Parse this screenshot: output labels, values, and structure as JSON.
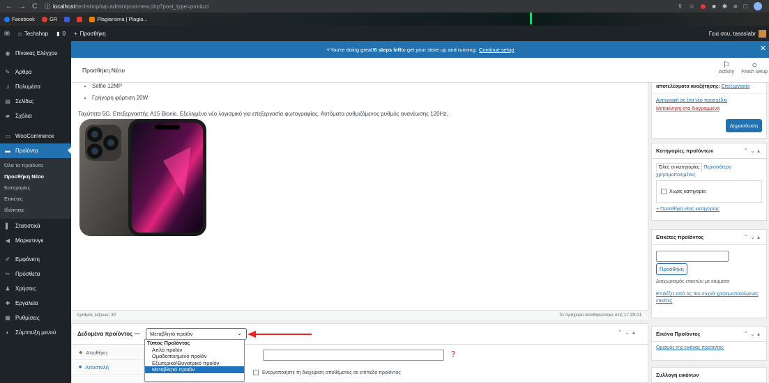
{
  "browser": {
    "url_host": "localhost",
    "url_path": "/techshop/wp-admin/post-new.php?post_type=product",
    "bookmarks": [
      {
        "label": "Facebook",
        "color": "#1877f2"
      },
      {
        "label": "GR",
        "color": "#e53935"
      },
      {
        "label": "",
        "color": "#3b5bdb"
      },
      {
        "label": "",
        "color": "#e53935"
      },
      {
        "label": "Plagiarisma | Plagia...",
        "color": "#f57c00"
      }
    ]
  },
  "adminbar": {
    "site": "Techshop",
    "comments": "0",
    "new_label": "Προσθήκη",
    "greeting": "Γεια σου, tasoslabr"
  },
  "sidebar": {
    "items": [
      {
        "label": "Πίνακας Ελέγχου",
        "icon": "dashboard-icon"
      },
      {
        "label": "Άρθρα",
        "icon": "pin-icon"
      },
      {
        "label": "Πολυμέσα",
        "icon": "media-icon"
      },
      {
        "label": "Σελίδες",
        "icon": "page-icon"
      },
      {
        "label": "Σχόλια",
        "icon": "comment-icon"
      },
      {
        "label": "WooCommerce",
        "icon": "woo-icon"
      },
      {
        "label": "Προϊόντα",
        "icon": "product-icon"
      }
    ],
    "submenu": [
      "Όλα τα προϊόντα",
      "Προσθήκη Νέου",
      "Κατηγορίες",
      "Ετικέτες",
      "Ιδιότητες"
    ],
    "items2": [
      {
        "label": "Στατιστικά",
        "icon": "chart-icon"
      },
      {
        "label": "Μαρκετινγκ",
        "icon": "megaphone-icon"
      },
      {
        "label": "Εμφάνιση",
        "icon": "brush-icon"
      },
      {
        "label": "Πρόσθετα",
        "icon": "plugin-icon"
      },
      {
        "label": "Χρήστες",
        "icon": "users-icon"
      },
      {
        "label": "Εργαλεία",
        "icon": "tools-icon"
      },
      {
        "label": "Ρυθμίσεις",
        "icon": "settings-icon"
      },
      {
        "label": "Σύμπτυξη μενού",
        "icon": "collapse-icon"
      }
    ]
  },
  "notice": {
    "text": "You're doing great! ",
    "bold": "6 steps left",
    "rest": " to get your store up and running.",
    "link": "Continue setup"
  },
  "header": {
    "title": "Προσθήκη Νέου",
    "activity": "Activity",
    "finish": "Finish setup"
  },
  "editor": {
    "bullets": [
      "Selfie 12MP",
      "Γρήγορη φόρτιση 20W"
    ],
    "description": "Ταχύτητα 5G. Επεξεργαστής A15 Bionic. Εξελιγμένο νέο λογισμικό για επεξεργασία φωτογραφίας. Αυτόματα ρυθμιζόμενος ρυθμός ανανέωσης 120Hz.",
    "word_count": "Αριθμός λέξεων: 30",
    "draft_saved": "Το πρόχειρο αποθηκεύτηκε στις 17:39:01."
  },
  "publish": {
    "line1": "αποτελέσματα αναζήτησης:",
    "line1_link": "Επεξεργασία",
    "copy_link": "Αντιγραφή σε ένα νέο προσχέδιο",
    "trash_link": "Μετακίνηση στα διαγραμμένα",
    "publish_btn": "Δημοσίευση"
  },
  "categories": {
    "title": "Κατηγορίες προϊόντων",
    "tab_all": "Όλες οι κατηγορίες",
    "tab_popular": "Περισσότερο χρησιμοποιημένες",
    "uncategorized": "Χωρίς κατηγορία",
    "add_link": "+ Προσθήκη νέας κατηγορίας"
  },
  "tags": {
    "title": "Ετικέτες προϊόντος",
    "add_btn": "Προσθήκη",
    "help": "Διαχωρισμός ετικετών με κόμματα",
    "choose_link": "Επιλέξτε από τις πιο συχνά χρησιμοποιούμενες ετικέτες"
  },
  "image_box": {
    "title": "Εικόνα Προϊόντος",
    "set_link": "Ορισμός της εικόνας προϊόντος"
  },
  "gallery_box": {
    "title": "Συλλογή εικόνων"
  },
  "product_data": {
    "label": "Δεδομένα προϊόντος —",
    "selected": "Μεταβλητό προϊόν",
    "tabs": [
      {
        "label": "Αποθήκη",
        "icon": "inventory-icon"
      },
      {
        "label": "Αποστολή",
        "icon": "truck-icon"
      }
    ],
    "manage_stock": "Ενεργοποιήστε τη διαχείριση αποθέματος σε επίπεδο προϊόντος"
  },
  "dropdown": {
    "group": "Τύπος Προϊόντος",
    "options": [
      "Απλό προϊόν",
      "Ομαδοποιημένο προϊόν",
      "Εξωτερικό/Θυγατρικό προϊόν",
      "Μεταβλητό προϊόν"
    ],
    "selected_index": 3
  },
  "colors": {
    "accent": "#2271b1",
    "admin_dark": "#1d2327",
    "annotation_arrow": "#e8262a"
  }
}
